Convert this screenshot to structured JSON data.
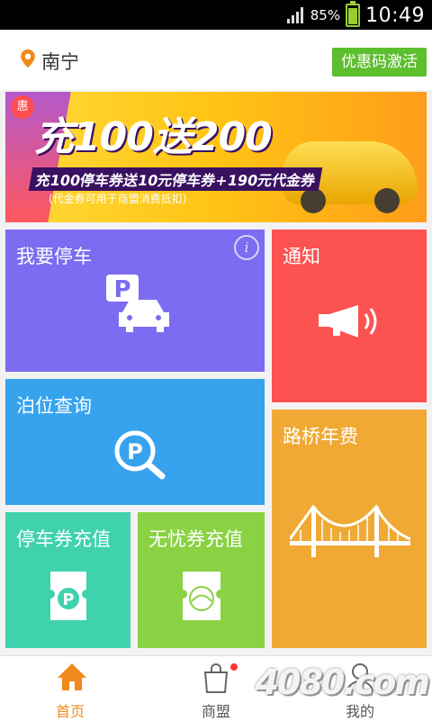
{
  "status_bar": {
    "battery_pct": "85%",
    "time": "10:49"
  },
  "header": {
    "city": "南宁",
    "promo_button": "优惠码激活"
  },
  "banner": {
    "badge": "惠",
    "headline": "充100送200",
    "subline": "充100停车券送10元停车券+190元代金券",
    "note": "(代金券可用于商盟消费抵扣)"
  },
  "tiles": {
    "park": {
      "label": "我要停车"
    },
    "notice": {
      "label": "通知"
    },
    "query": {
      "label": "泊位查询"
    },
    "bridge": {
      "label": "路桥年费"
    },
    "coupon": {
      "label": "停车券充值"
    },
    "worry": {
      "label": "无忧券充值"
    }
  },
  "nav": {
    "home": "首页",
    "shop": "商盟",
    "mine": "我的"
  },
  "watermark": "4080.com",
  "colors": {
    "park": "#7c6cf1",
    "notice": "#fd5252",
    "query": "#37a3ee",
    "bridge": "#f0a934",
    "coupon": "#3fd2ad",
    "worry": "#8ad244",
    "accent": "#f08a1c",
    "promo": "#5dbe2e"
  }
}
